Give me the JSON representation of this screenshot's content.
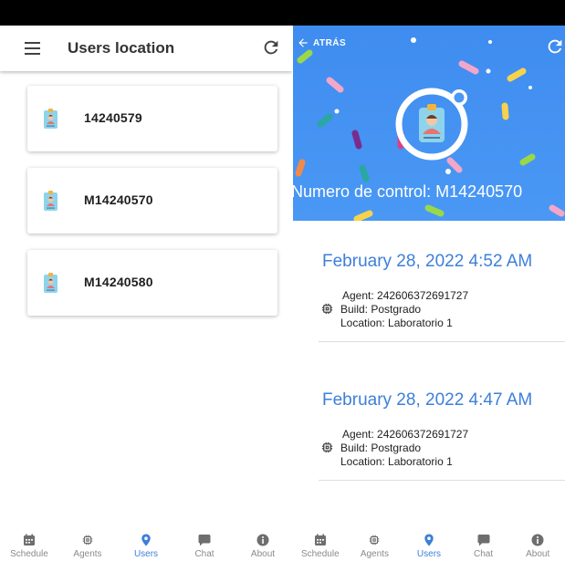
{
  "left_screen": {
    "title": "Users location",
    "users": [
      {
        "label": "14240579"
      },
      {
        "label": "M14240570"
      },
      {
        "label": "M14240580"
      }
    ]
  },
  "right_screen": {
    "back_label": "ATRÁS",
    "caption": "Numero de control: M14240570",
    "entries": [
      {
        "date": "February 28, 2022 4:52 AM",
        "agent": "Agent: 242606372691727",
        "build": "Build: Postgrado",
        "location": "Location: Laboratorio 1"
      },
      {
        "date": "February 28, 2022 4:47 AM",
        "agent": "Agent: 242606372691727",
        "build": "Build: Postgrado",
        "location": "Location: Laboratorio 1"
      }
    ]
  },
  "bottom_nav": {
    "active": "users",
    "items": [
      {
        "id": "schedule",
        "label": "Schedule",
        "icon": "calendar-icon"
      },
      {
        "id": "agents",
        "label": "Agents",
        "icon": "chip-icon"
      },
      {
        "id": "users",
        "label": "Users",
        "icon": "location-pin-icon"
      },
      {
        "id": "chat",
        "label": "Chat",
        "icon": "chat-bubble-icon"
      },
      {
        "id": "about",
        "label": "About",
        "icon": "info-icon"
      }
    ]
  },
  "colors": {
    "accent": "#3d7fd9",
    "hero_blue": "#4a98f4",
    "inactive": "#8a8a8a"
  }
}
